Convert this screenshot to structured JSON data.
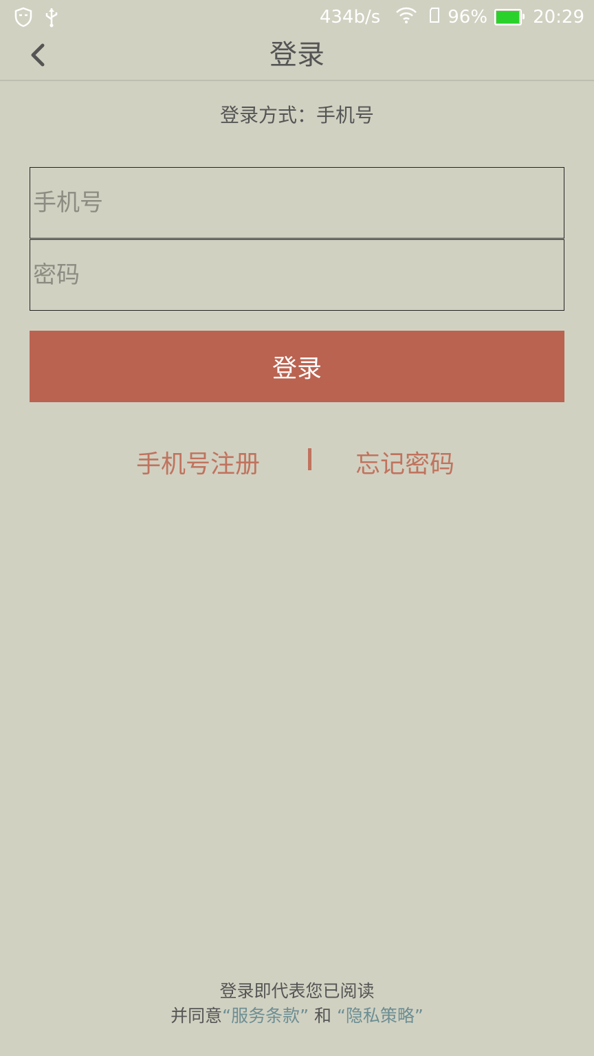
{
  "status_bar": {
    "net_speed": "434b/s",
    "battery_percent": "96%",
    "battery_level": 96,
    "time": "20:29",
    "icons": [
      "shield-icon",
      "usb-icon",
      "wifi-icon",
      "sim-icon",
      "battery-icon"
    ]
  },
  "header": {
    "title": "登录",
    "back_icon": "chevron-left-icon"
  },
  "login_method": "登录方式：手机号",
  "form": {
    "phone_placeholder": "手机号",
    "password_placeholder": "密码",
    "login_label": "登录"
  },
  "links": {
    "register": "手机号注册",
    "forgot": "忘记密码"
  },
  "footer": {
    "line1": "登录即代表您已阅读",
    "agree_prefix": "并同意",
    "terms": "“服务条款”",
    "and": " 和 ",
    "privacy": "“隐私策略”"
  },
  "colors": {
    "background": "#d1d1c2",
    "accent": "#ba6350",
    "link": "#c0735d",
    "policy_link": "#6c8e93"
  }
}
